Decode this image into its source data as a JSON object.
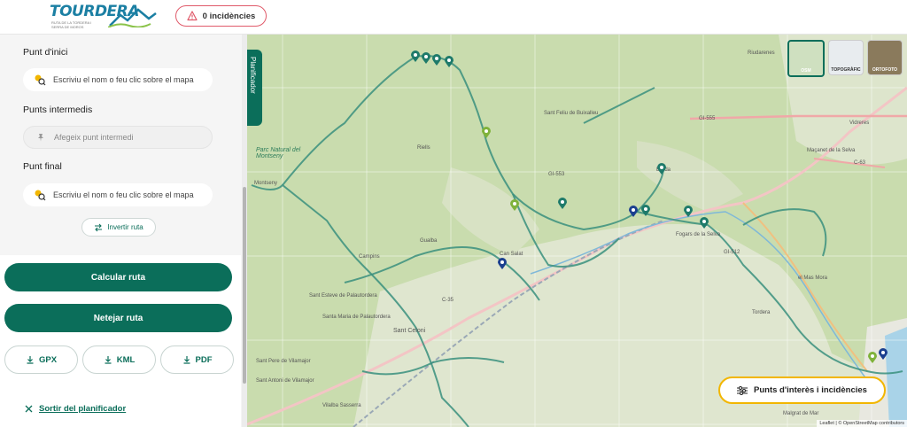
{
  "header": {
    "logo": {
      "title": "TOURDERA",
      "subtitle": "RUTA DE LA TORDERA I SERRA DE MOROS"
    },
    "incidents_label": "0 incidències"
  },
  "planner": {
    "start_label": "Punt d'inici",
    "start_placeholder": "Escriviu el nom o feu clic sobre el mapa",
    "waypoints_label": "Punts intermedis",
    "waypoint_placeholder": "Afegeix punt intermedi",
    "end_label": "Punt final",
    "end_placeholder": "Escriviu el nom o feu clic sobre el mapa",
    "invert_label": "Invertir ruta",
    "calculate_label": "Calcular ruta",
    "clear_label": "Netejar ruta",
    "export": {
      "gpx": "GPX",
      "kml": "KML",
      "pdf": "PDF"
    },
    "exit_label": "Sortir del planificador"
  },
  "map": {
    "planner_tab": "Planificador",
    "layers": [
      {
        "label": "OSM",
        "active": true
      },
      {
        "label": "TOPOGRÀFIC",
        "active": false
      },
      {
        "label": "ORTOFOTO",
        "active": false
      }
    ],
    "poi_button": "Punts d'interès i incidències",
    "attribution": "Leaflet | © OpenStreetMap contributors",
    "place_labels": {
      "riudarenes": "Riudarenes",
      "sant_feliu": "Sant Feliu de Buixalleu",
      "parc": "Parc Natural del Montseny",
      "gi555": "GI-555",
      "gi553": "GI-553",
      "gi512": "GI-512",
      "vidreres": "Vidreres",
      "macanet": "Maçanet de la Selva",
      "c63": "C-63",
      "breda": "Breda",
      "gualba": "Gualba",
      "campins": "Campins",
      "can_salat": "Can Salat",
      "fogars": "Fogars de la Selva",
      "sant_esteve": "Sant Esteve de Palautordera",
      "santa_maria": "Santa Maria de Palautordera",
      "sant_celoni": "Sant Celoni",
      "sant_pere": "Sant Pere de Vilamajor",
      "vilamajor": "Sant Antoni de Vilamajor",
      "tordera": "Tordera",
      "mas_mora": "el Mas Mora",
      "malgrat": "Malgrat de Mar",
      "vilalba": "Vilalba Sasserra",
      "c35": "C-35",
      "montseny": "Montseny",
      "riells": "Riells"
    }
  },
  "colors": {
    "primary": "#0b6e5a",
    "accent": "#f2b600",
    "incident_border": "#e05a6a"
  }
}
